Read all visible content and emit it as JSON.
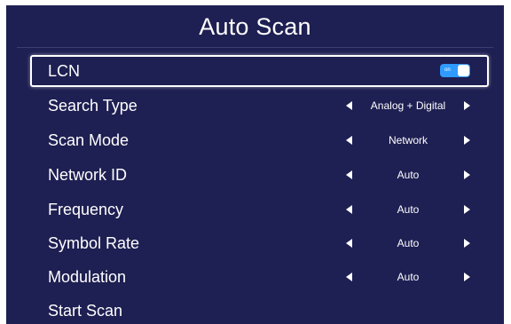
{
  "colors": {
    "background": "#1e1f52",
    "text": "#ffffff",
    "toggle_on": "#2f9bff",
    "focus_border": "#ffffff"
  },
  "header": {
    "title": "Auto Scan"
  },
  "lcn": {
    "label": "LCN",
    "toggle_state": "on",
    "toggle_text": "on"
  },
  "settings": [
    {
      "label": "Search Type",
      "value": "Analog + Digital"
    },
    {
      "label": "Scan Mode",
      "value": "Network"
    },
    {
      "label": "Network ID",
      "value": "Auto"
    },
    {
      "label": "Frequency",
      "value": "Auto"
    },
    {
      "label": "Symbol Rate",
      "value": "Auto"
    },
    {
      "label": "Modulation",
      "value": "Auto"
    }
  ],
  "start_scan": {
    "label": "Start Scan"
  },
  "icons": {
    "left_arrow": "triangle-left-icon",
    "right_arrow": "triangle-right-icon"
  }
}
